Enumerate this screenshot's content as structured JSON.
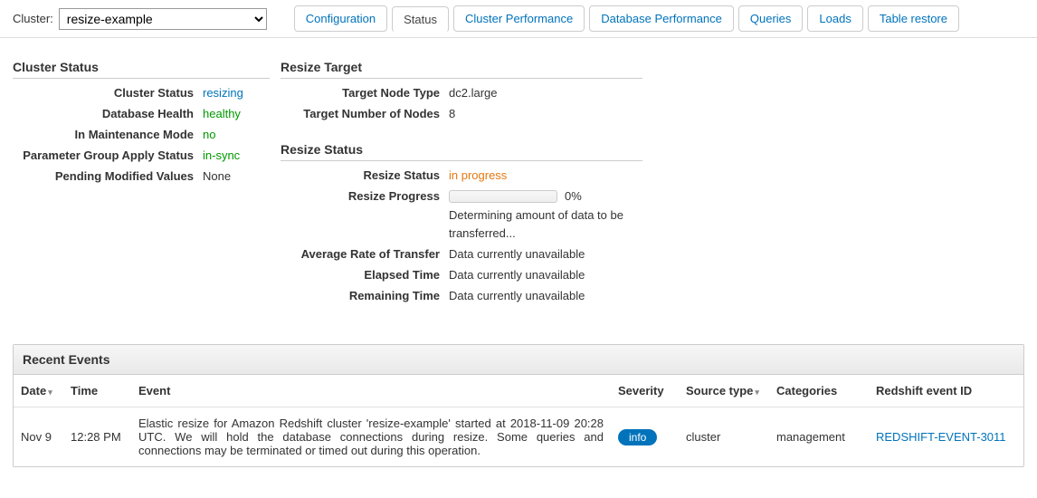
{
  "header": {
    "cluster_label": "Cluster:",
    "cluster_selected": "resize-example",
    "tabs": [
      "Configuration",
      "Status",
      "Cluster Performance",
      "Database Performance",
      "Queries",
      "Loads",
      "Table restore"
    ],
    "active_tab_index": 1
  },
  "cluster_status": {
    "title": "Cluster Status",
    "rows": {
      "status_label": "Cluster Status",
      "status_value": "resizing",
      "db_health_label": "Database Health",
      "db_health_value": "healthy",
      "maintenance_label": "In Maintenance Mode",
      "maintenance_value": "no",
      "pg_apply_label": "Parameter Group Apply Status",
      "pg_apply_value": "in-sync",
      "pending_label": "Pending Modified Values",
      "pending_value": "None"
    }
  },
  "resize_target": {
    "title": "Resize Target",
    "rows": {
      "node_type_label": "Target Node Type",
      "node_type_value": "dc2.large",
      "num_nodes_label": "Target Number of Nodes",
      "num_nodes_value": "8"
    }
  },
  "resize_status": {
    "title": "Resize Status",
    "rows": {
      "status_label": "Resize Status",
      "status_value": "in progress",
      "progress_label": "Resize Progress",
      "progress_pct": "0%",
      "progress_note": "Determining amount of data to be transferred...",
      "rate_label": "Average Rate of Transfer",
      "rate_value": "Data currently unavailable",
      "elapsed_label": "Elapsed Time",
      "elapsed_value": "Data currently unavailable",
      "remaining_label": "Remaining Time",
      "remaining_value": "Data currently unavailable"
    }
  },
  "events": {
    "title": "Recent Events",
    "columns": {
      "date": "Date",
      "time": "Time",
      "event": "Event",
      "severity": "Severity",
      "source_type": "Source type",
      "categories": "Categories",
      "eid": "Redshift event ID"
    },
    "rows": [
      {
        "date": "Nov 9",
        "time": "12:28 PM",
        "event": "Elastic resize for Amazon Redshift cluster 'resize-example' started at 2018-11-09 20:28 UTC. We will hold the database connections during resize. Some queries and connections may be terminated or timed out during this operation.",
        "severity": "info",
        "source_type": "cluster",
        "categories": "management",
        "eid": "REDSHIFT-EVENT-3011"
      }
    ]
  }
}
